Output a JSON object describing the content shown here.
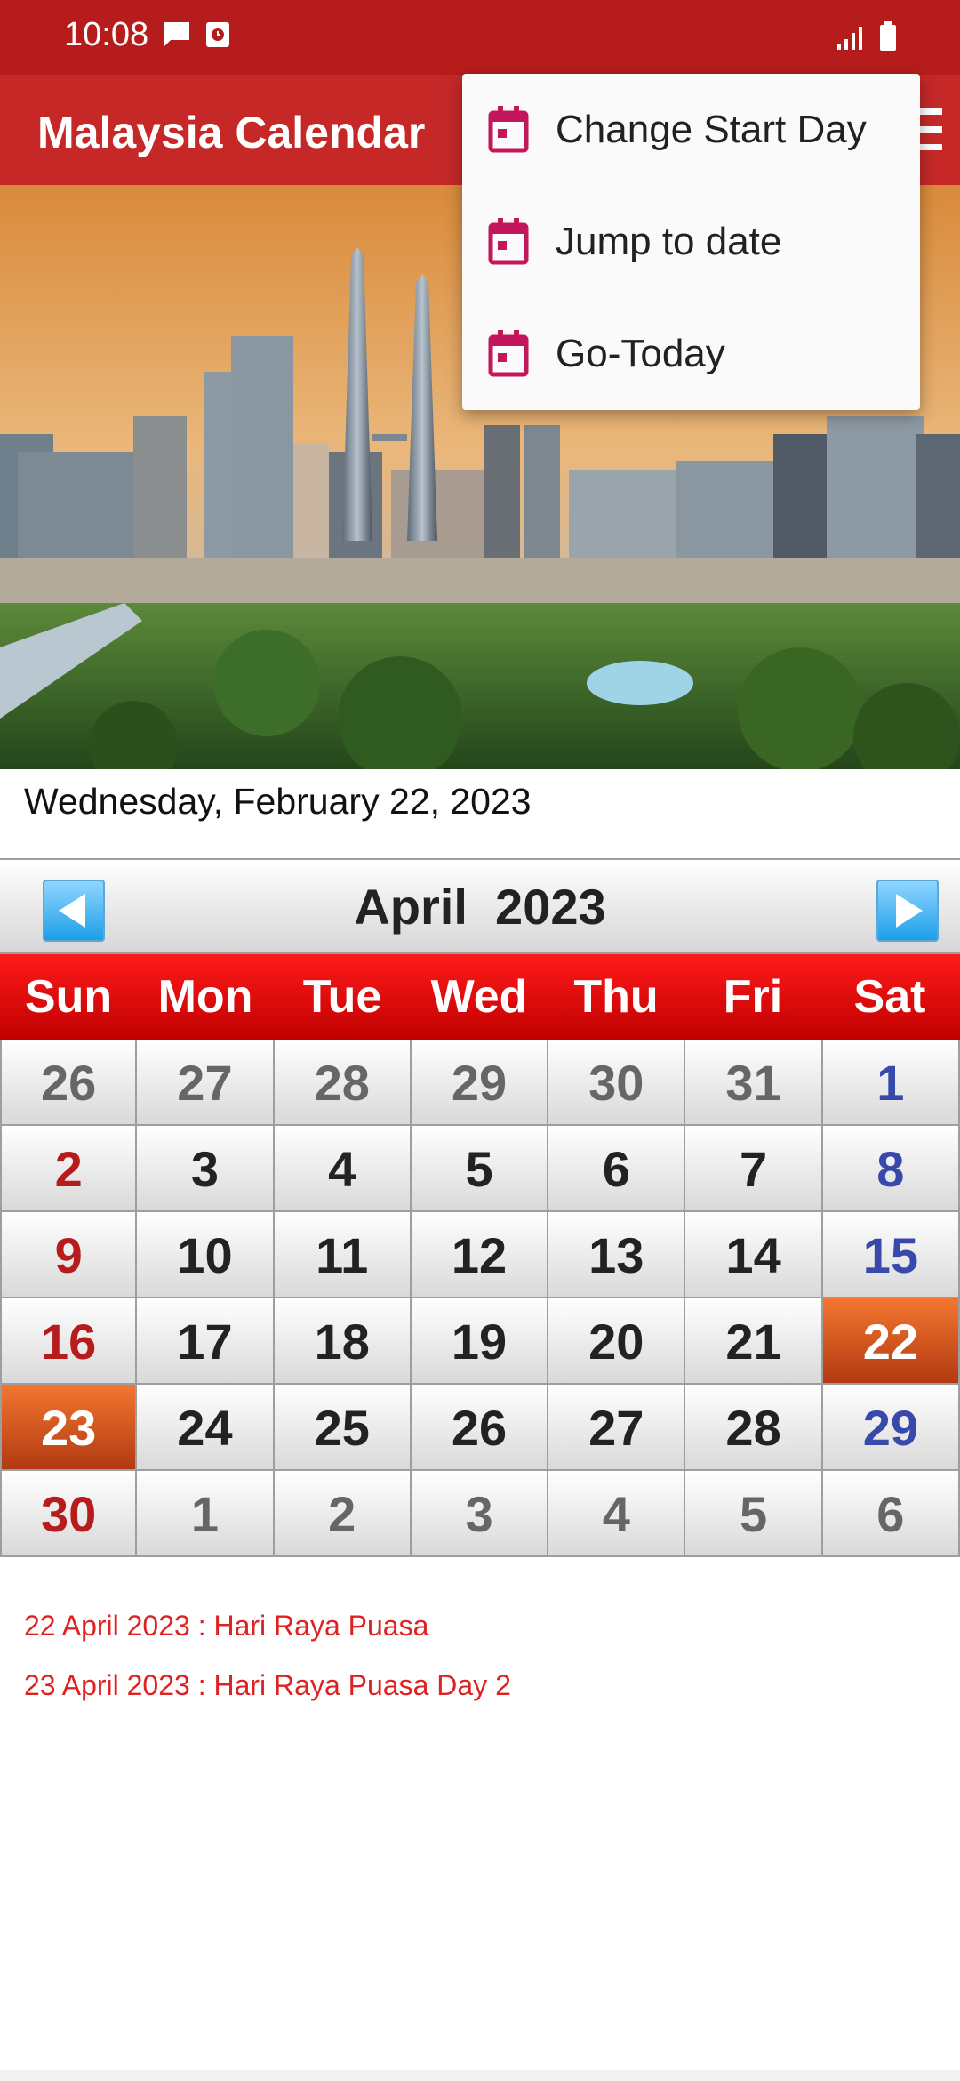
{
  "status_bar": {
    "time": "10:08"
  },
  "app_bar": {
    "title": "Malaysia Calendar"
  },
  "dropdown": {
    "items": [
      {
        "label": "Change Start Day",
        "icon": "calendar-icon"
      },
      {
        "label": "Jump to date",
        "icon": "calendar-icon"
      },
      {
        "label": "Go-Today",
        "icon": "calendar-icon"
      }
    ]
  },
  "selected_date": "Wednesday, February 22, 2023",
  "calendar": {
    "month": "April",
    "year": "2023",
    "weekdays": [
      "Sun",
      "Mon",
      "Tue",
      "Wed",
      "Thu",
      "Fri",
      "Sat"
    ],
    "weeks": [
      [
        "26",
        "27",
        "28",
        "29",
        "30",
        "31",
        "1"
      ],
      [
        "2",
        "3",
        "4",
        "5",
        "6",
        "7",
        "8"
      ],
      [
        "9",
        "10",
        "11",
        "12",
        "13",
        "14",
        "15"
      ],
      [
        "16",
        "17",
        "18",
        "19",
        "20",
        "21",
        "22"
      ],
      [
        "23",
        "24",
        "25",
        "26",
        "27",
        "28",
        "29"
      ],
      [
        "30",
        "1",
        "2",
        "3",
        "4",
        "5",
        "6"
      ]
    ]
  },
  "holidays": [
    "22 April 2023 : Hari Raya Puasa",
    "23 April 2023 : Hari Raya Puasa Day 2"
  ],
  "colors": {
    "app_bar": "#c62828",
    "status_bar": "#b71c1c",
    "holiday_text": "#e02121",
    "holiday_cell": "#d9531e"
  }
}
